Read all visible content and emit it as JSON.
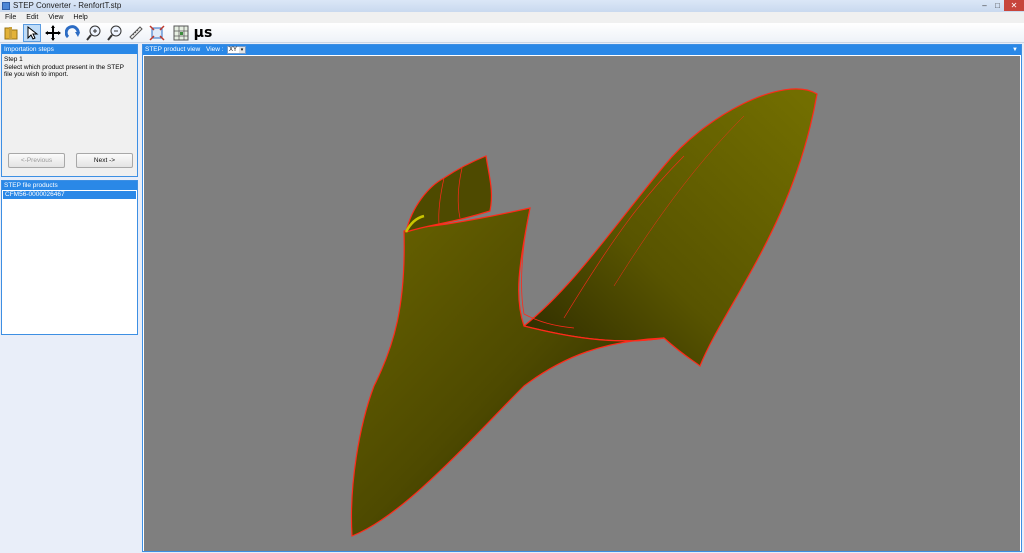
{
  "window": {
    "title": "STEP Converter - RenfortT.stp"
  },
  "window_controls": {
    "minimize": "–",
    "maximize": "□",
    "close": "✕"
  },
  "menu": [
    "File",
    "Edit",
    "View",
    "Help"
  ],
  "toolbar": {
    "tools": [
      "open-folder-icon",
      "select-pointer-icon",
      "pan-move-icon",
      "rotate-icon",
      "zoom-in-icon",
      "zoom-out-icon",
      "measure-ruler-icon",
      "fit-view-icon",
      "grid-icon"
    ],
    "active_tool": "select-pointer-icon",
    "units_label": "µs"
  },
  "importation": {
    "header": "Importation steps",
    "step_title": "Step 1",
    "step_description": "Select which product present in the STEP file you wish to import.",
    "previous_label": "<-Previous",
    "next_label": "Next ->"
  },
  "products": {
    "header": "STEP file products",
    "items": [
      "CFM56-0000026467"
    ]
  },
  "view": {
    "header": "STEP product view",
    "view_label": "View :",
    "view_selected": "XY",
    "collapse_icon": "▼"
  },
  "colors": {
    "accent": "#2a88e7",
    "viewport_bg": "#7f7f7f",
    "surface": "#5b5700",
    "edges": "#ff2a1a"
  }
}
